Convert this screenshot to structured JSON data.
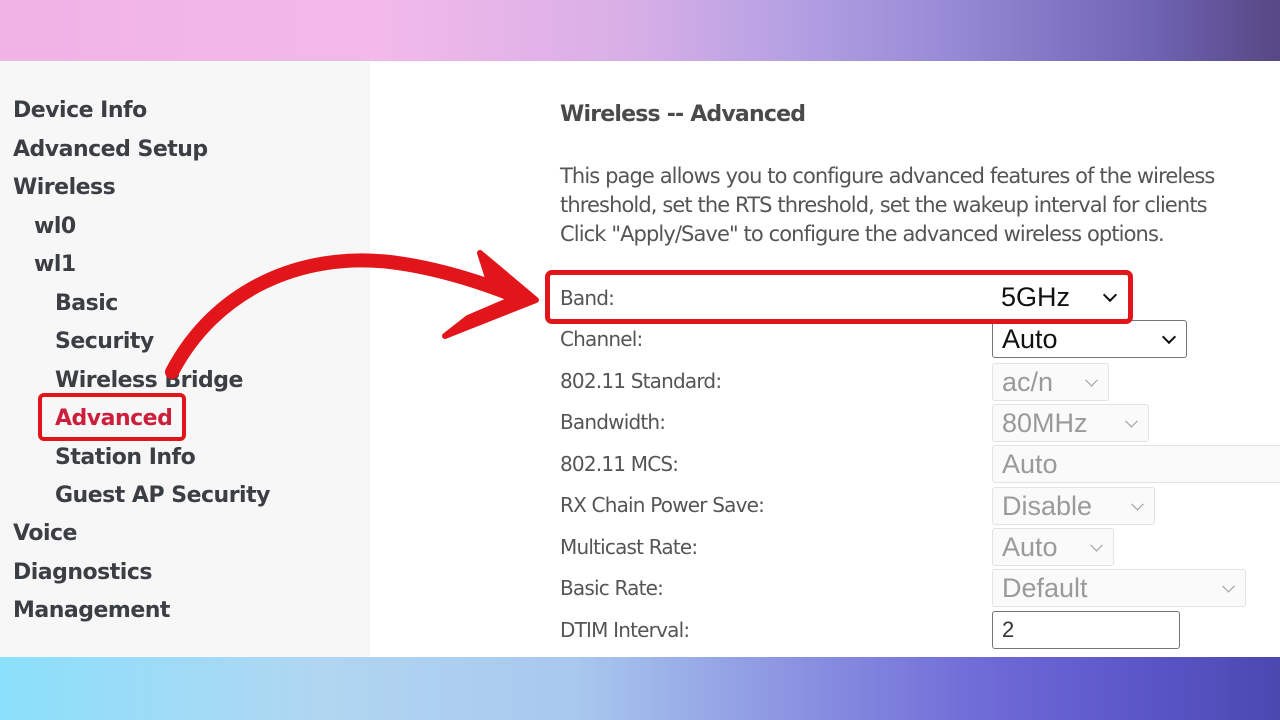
{
  "sidebar": {
    "items": [
      {
        "label": "Device Info",
        "level": 0
      },
      {
        "label": "Advanced Setup",
        "level": 0
      },
      {
        "label": "Wireless",
        "level": 0
      },
      {
        "label": "wl0",
        "level": 1
      },
      {
        "label": "wl1",
        "level": 1
      },
      {
        "label": "Basic",
        "level": 2
      },
      {
        "label": "Security",
        "level": 2
      },
      {
        "label": "Wireless Bridge",
        "level": 2
      },
      {
        "label": "Advanced",
        "level": 2,
        "active": true
      },
      {
        "label": "Station Info",
        "level": 2
      },
      {
        "label": "Guest AP Security",
        "level": 2
      },
      {
        "label": "Voice",
        "level": 0
      },
      {
        "label": "Diagnostics",
        "level": 0
      },
      {
        "label": "Management",
        "level": 0
      }
    ]
  },
  "main": {
    "title": "Wireless -- Advanced",
    "description": [
      "This page allows you to configure advanced features of the wireless",
      "threshold, set the RTS threshold, set the wakeup interval for clients",
      "Click \"Apply/Save\" to configure the advanced wireless options."
    ],
    "fields": [
      {
        "label": "Band:",
        "value": "5GHz",
        "type": "select",
        "enabled": true
      },
      {
        "label": "Channel:",
        "value": "Auto",
        "type": "select",
        "enabled": true
      },
      {
        "label": "802.11 Standard:",
        "value": "ac/n",
        "type": "select",
        "enabled": false
      },
      {
        "label": "Bandwidth:",
        "value": "80MHz",
        "type": "select",
        "enabled": false
      },
      {
        "label": "802.11 MCS:",
        "value": "Auto",
        "type": "select",
        "enabled": false
      },
      {
        "label": "RX Chain Power Save:",
        "value": "Disable",
        "type": "select",
        "enabled": false
      },
      {
        "label": "Multicast Rate:",
        "value": "Auto",
        "type": "select",
        "enabled": false
      },
      {
        "label": "Basic Rate:",
        "value": "Default",
        "type": "select",
        "enabled": false
      },
      {
        "label": "DTIM Interval:",
        "value": "2",
        "type": "text",
        "enabled": true
      }
    ]
  },
  "annotations": {
    "highlight_color": "#e2151b",
    "highlighted_nav_item": "Advanced",
    "highlighted_field": "Band:"
  },
  "colors": {
    "active_nav": "#cc1f3c",
    "nav_text": "#3b3f44",
    "label_text": "#555555"
  }
}
